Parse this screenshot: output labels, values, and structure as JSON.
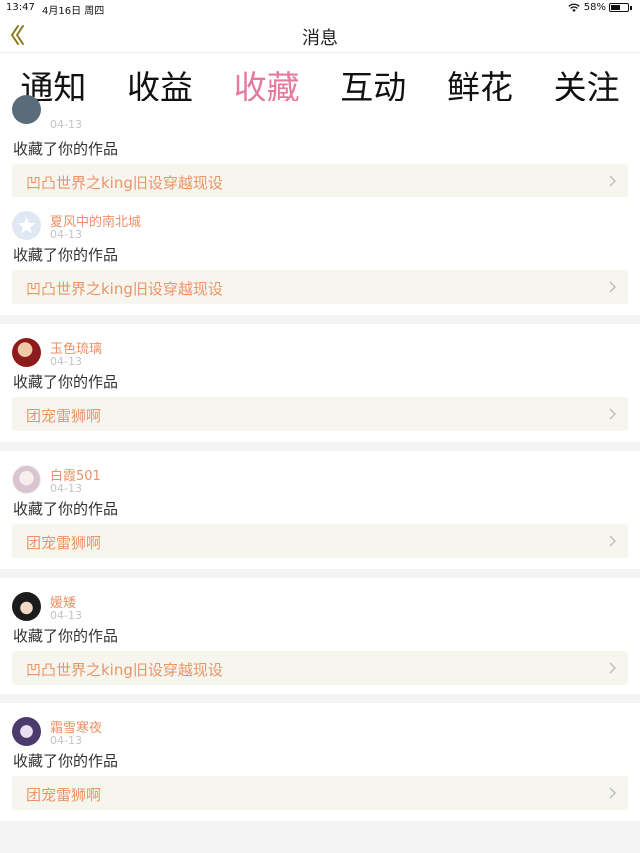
{
  "status_bar": {
    "time": "13:47",
    "date": "4月16日 周四",
    "battery": "58%",
    "battery_level": 0.58
  },
  "nav": {
    "title": "消息"
  },
  "tabs": [
    {
      "label": "通知",
      "active": false
    },
    {
      "label": "收益",
      "active": false
    },
    {
      "label": "收藏",
      "active": true
    },
    {
      "label": "互动",
      "active": false
    },
    {
      "label": "鲜花",
      "active": false
    },
    {
      "label": "关注",
      "active": false
    }
  ],
  "messages": [
    {
      "user": "",
      "date": "04-13",
      "action": "收藏了你的作品",
      "work": "凹凸世界之king旧设穿越现设",
      "avatar": "avatar-partial"
    },
    {
      "user": "夏风中的南北城",
      "date": "04-13",
      "action": "收藏了你的作品",
      "work": "凹凸世界之king旧设穿越现设",
      "avatar": "default-star-avatar"
    },
    {
      "user": "玉色琉璃",
      "date": "04-13",
      "action": "收藏了你的作品",
      "work": "团宠雷狮啊",
      "avatar": "red-avatar"
    },
    {
      "user": "白霞501",
      "date": "04-13",
      "action": "收藏了你的作品",
      "work": "团宠雷狮啊",
      "avatar": "pale-avatar"
    },
    {
      "user": "媛矮",
      "date": "04-13",
      "action": "收藏了你的作品",
      "work": "凹凸世界之king旧设穿越现设",
      "avatar": "dark-avatar"
    },
    {
      "user": "霜雪寒夜",
      "date": "04-13",
      "action": "收藏了你的作品",
      "work": "团宠雷狮啊",
      "avatar": "purple-avatar"
    }
  ],
  "colors": {
    "accent": "#e8799e",
    "work_text": "#ec9466",
    "username": "#ee8f66",
    "back_arrow": "#8a7a1e"
  }
}
